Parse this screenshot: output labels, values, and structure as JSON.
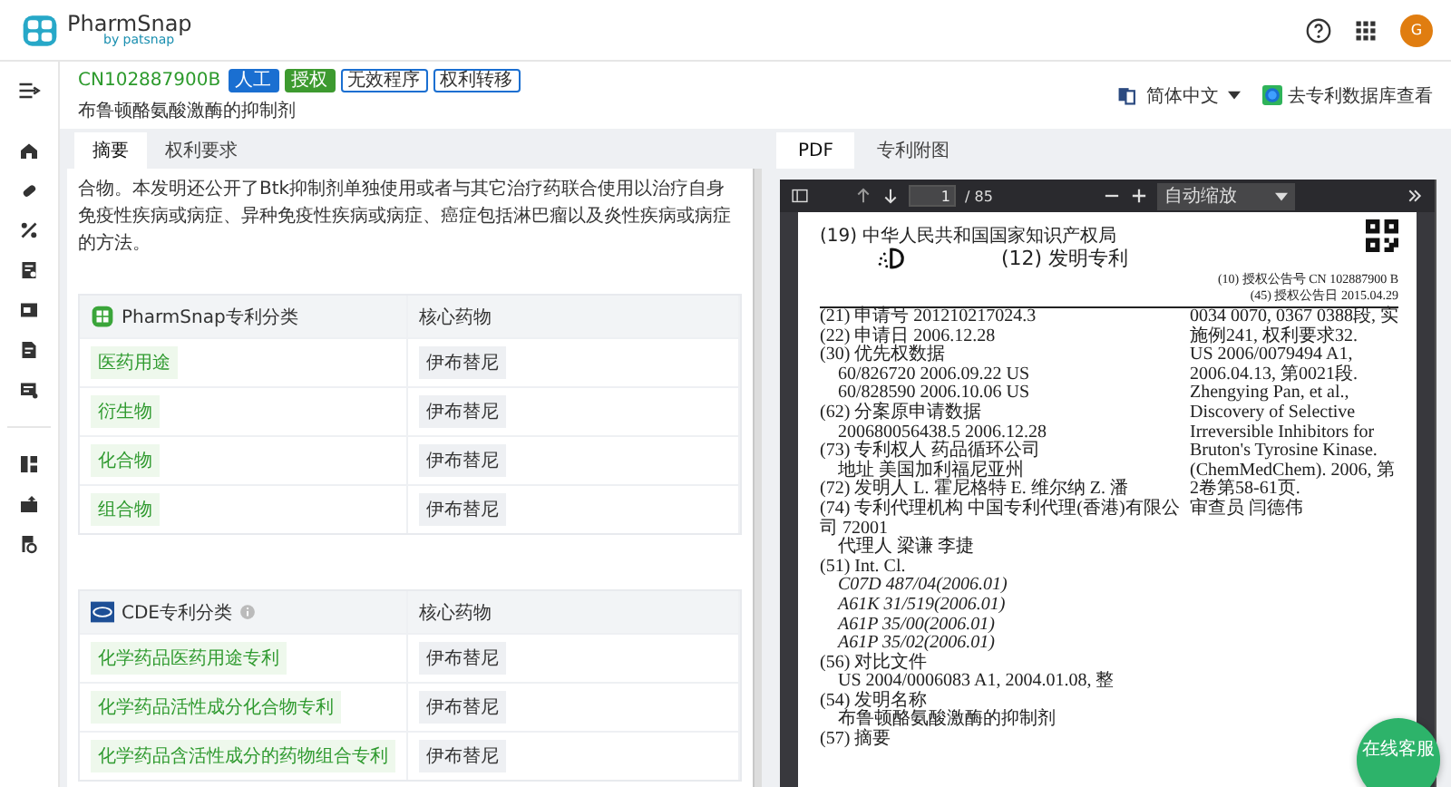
{
  "header": {
    "logo_name": "PharmSnap",
    "logo_sub": "by patsnap",
    "avatar": "G"
  },
  "patent": {
    "number": "CN102887900B",
    "badges": [
      {
        "label": "人工",
        "kind": "solid",
        "color": "#1a6fd1"
      },
      {
        "label": "授权",
        "kind": "solid",
        "color": "#3d9a2f"
      },
      {
        "label": "无效程序",
        "kind": "outline",
        "color": "#1a6fd1"
      },
      {
        "label": "权利转移",
        "kind": "outline",
        "color": "#1a6fd1"
      }
    ],
    "title": "布鲁顿酪氨酸激酶的抑制剂",
    "language": "简体中文",
    "database_link": "去专利数据库查看"
  },
  "left_panel": {
    "tabs": [
      {
        "label": "摘要",
        "selected": true
      },
      {
        "label": "权利要求",
        "selected": false
      }
    ],
    "abstract": "合物。本发明还公开了Btk抑制剂单独使用或者与其它治疗药联合使用以治疗自身免疫性疾病或病症、异种免疫性疾病或病症、癌症包括淋巴瘤以及炎性疾病或病症的方法。",
    "tables": [
      {
        "heading": "PharmSnap专利分类",
        "info": false,
        "column_2": "核心药物",
        "rows": [
          {
            "category": "医药用途",
            "drug": "伊布替尼"
          },
          {
            "category": "衍生物",
            "drug": "伊布替尼"
          },
          {
            "category": "化合物",
            "drug": "伊布替尼"
          },
          {
            "category": "组合物",
            "drug": "伊布替尼"
          }
        ]
      },
      {
        "heading": "CDE专利分类",
        "info": true,
        "column_2": "核心药物",
        "rows": [
          {
            "category": "化学药品医药用途专利",
            "drug": "伊布替尼"
          },
          {
            "category": "化学药品活性成分化合物专利",
            "drug": "伊布替尼"
          },
          {
            "category": "化学药品含活性成分的药物组合专利",
            "drug": "伊布替尼"
          }
        ]
      }
    ]
  },
  "pdf_viewer": {
    "tabs": [
      {
        "label": "PDF",
        "selected": true
      },
      {
        "label": "专利附图",
        "selected": false
      }
    ],
    "toolbar": {
      "page": "1",
      "total": "/ 85",
      "zoom": "自动缩放"
    },
    "page": {
      "office": "(19) 中华人民共和国国家知识产权局",
      "doc_type": "(12) 发明专利",
      "pub_number": "(10) 授权公告号 CN 102887900 B",
      "pub_date": "(45) 授权公告日 2015.04.29",
      "left_lines": [
        {
          "text": "(21) 申请号 201210217024.3",
          "kind": "field"
        },
        {
          "text": "(22) 申请日 2006.12.28",
          "kind": "field"
        },
        {
          "text": "(30) 优先权数据",
          "kind": "field"
        },
        {
          "text": "60/826720 2006.09.22 US",
          "kind": "value"
        },
        {
          "text": "60/828590 2006.10.06 US",
          "kind": "value"
        },
        {
          "text": "(62) 分案原申请数据",
          "kind": "field"
        },
        {
          "text": "200680056438.5 2006.12.28",
          "kind": "value"
        },
        {
          "text": "(73) 专利权人 药品循环公司",
          "kind": "field"
        },
        {
          "text": "地址 美国加利福尼亚州",
          "kind": "value"
        },
        {
          "text": "(72) 发明人 L. 霍尼格特 E. 维尔纳 Z. 潘",
          "kind": "field"
        },
        {
          "text": "(74) 专利代理机构 中国专利代理(香港)有限公司 72001",
          "kind": "field"
        },
        {
          "text": "代理人 梁谦 李捷",
          "kind": "value"
        },
        {
          "text": "(51) Int. Cl.",
          "kind": "field"
        },
        {
          "text": "C07D 487/04(2006.01)",
          "kind": "code"
        },
        {
          "text": "A61K 31/519(2006.01)",
          "kind": "code"
        },
        {
          "text": "A61P 35/00(2006.01)",
          "kind": "code"
        },
        {
          "text": "A61P 35/02(2006.01)",
          "kind": "code"
        },
        {
          "text": "(56) 对比文件",
          "kind": "field"
        },
        {
          "text": "US 2004/0006083 A1, 2004.01.08, 整",
          "kind": "value"
        },
        {
          "text": "(54) 发明名称",
          "kind": "field"
        },
        {
          "text": "布鲁顿酪氨酸激酶的抑制剂",
          "kind": "value"
        },
        {
          "text": "(57) 摘要",
          "kind": "field"
        }
      ],
      "right_lines": [
        "0034 0070, 0367 0388段, 实施例241, 权利要求32.",
        "US 2006/0079494 A1, 2006.04.13, 第0021段.",
        "Zhengying Pan, et al., Discovery of Selective Irreversible Inhibitors for Bruton's Tyrosine Kinase. (ChemMedChem). 2006, 第2卷第58-61页.",
        "审查员 闫德伟"
      ]
    }
  },
  "chat_button": "在线客服"
}
